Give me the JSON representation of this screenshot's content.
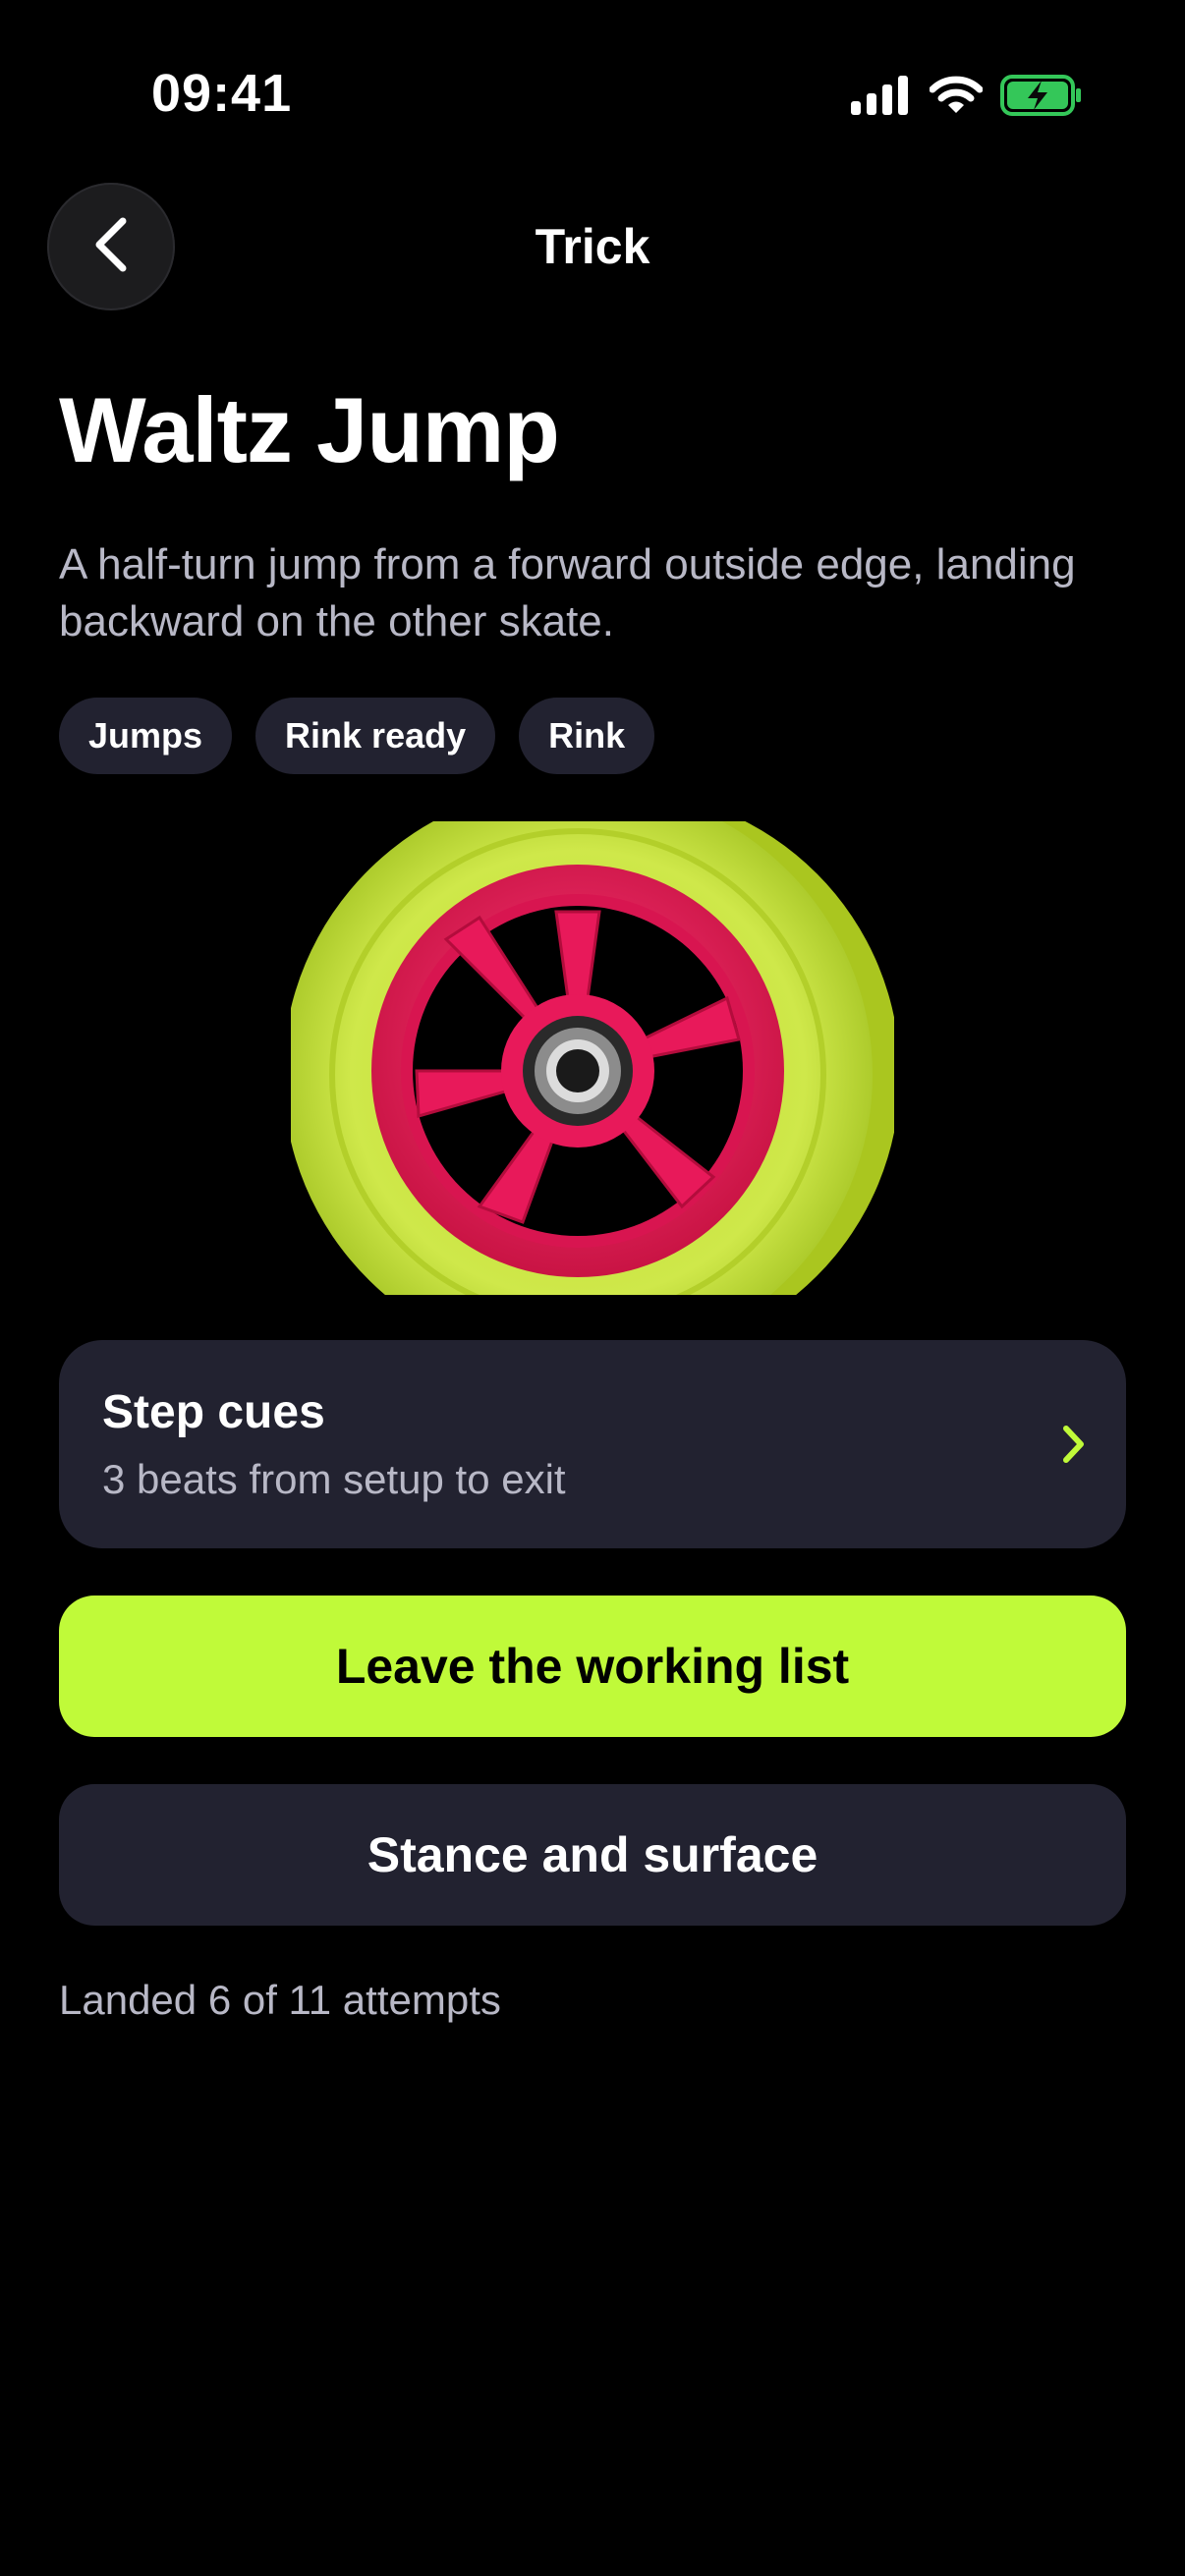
{
  "status_bar": {
    "time": "09:41",
    "signal_icon": "cellular-signal-icon",
    "wifi_icon": "wifi-icon",
    "battery_icon": "battery-charging-icon",
    "battery_color": "#34c759"
  },
  "nav": {
    "back_icon": "chevron-left-icon",
    "title": "Trick"
  },
  "trick": {
    "title": "Waltz Jump",
    "description": "A half-turn jump from a forward outside edge, landing backward on the other skate.",
    "tags": [
      "Jumps",
      "Rink ready",
      "Rink"
    ],
    "image": "skate-wheel-image"
  },
  "step_cues": {
    "title": "Step cues",
    "subtitle": "3 beats from setup to exit",
    "chevron_icon": "chevron-right-icon"
  },
  "actions": {
    "primary_label": "Leave the working list",
    "secondary_label": "Stance and surface"
  },
  "stats": {
    "attempts_text": "Landed 6 of 11 attempts"
  },
  "colors": {
    "accent": "#c0fa39",
    "background": "#000000",
    "surface": "#222230",
    "muted_text": "#b8b8c6",
    "wheel_tire": "#c9e43a",
    "wheel_hub": "#e8195a"
  }
}
